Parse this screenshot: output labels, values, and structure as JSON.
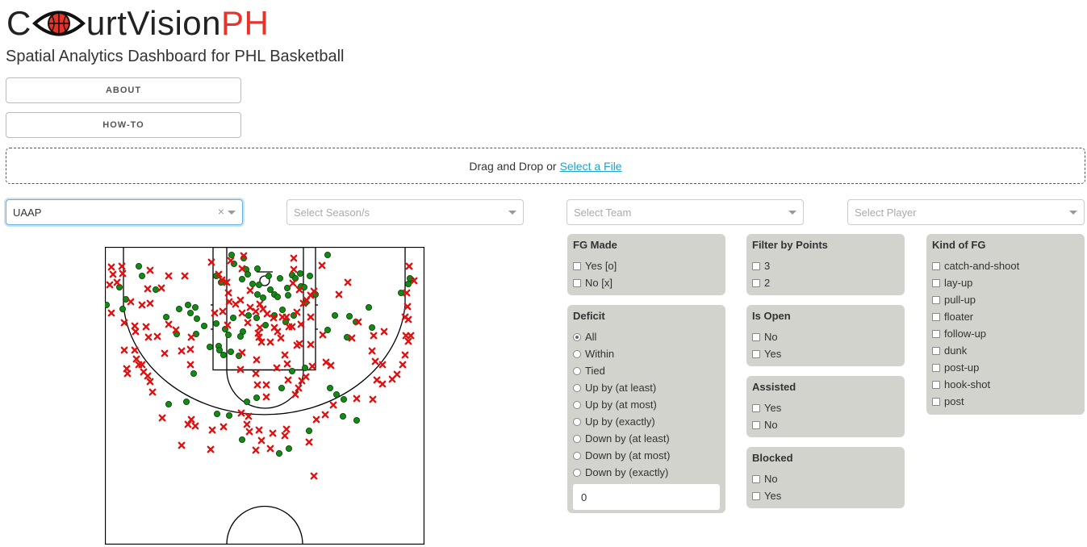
{
  "logo": {
    "part1": "C",
    "part2": "urtVision",
    "part3": "PH"
  },
  "subtitle": "Spatial Analytics Dashboard for PHL Basketball",
  "nav": {
    "about": "ABOUT",
    "howto": "HOW-TO"
  },
  "upload": {
    "text": "Drag and Drop or",
    "link": "Select a File"
  },
  "selects": {
    "league": {
      "value": "UAAP",
      "clear": "×"
    },
    "season": {
      "placeholder": "Select Season/s"
    },
    "team": {
      "placeholder": "Select Team"
    },
    "player": {
      "placeholder": "Select Player"
    }
  },
  "filters": {
    "fg_made": {
      "title": "FG Made",
      "options": [
        "Yes [o]",
        "No [x]"
      ]
    },
    "deficit": {
      "title": "Deficit",
      "options": [
        "All",
        "Within",
        "Tied",
        "Up by (at least)",
        "Up by (at most)",
        "Up by (exactly)",
        "Down by (at least)",
        "Down by (at most)",
        "Down by (exactly)"
      ],
      "selected": "All",
      "value": "0"
    },
    "points": {
      "title": "Filter by Points",
      "options": [
        "3",
        "2"
      ]
    },
    "is_open": {
      "title": "Is Open",
      "options": [
        "No",
        "Yes"
      ]
    },
    "assisted": {
      "title": "Assisted",
      "options": [
        "Yes",
        "No"
      ]
    },
    "blocked": {
      "title": "Blocked",
      "options": [
        "No",
        "Yes"
      ]
    },
    "kind": {
      "title": "Kind of FG",
      "options": [
        "catch-and-shoot",
        "lay-up",
        "pull-up",
        "floater",
        "follow-up",
        "dunk",
        "post-up",
        "hook-shot",
        "post"
      ]
    }
  },
  "colors": {
    "made": "#138a13",
    "missed": "#e01010",
    "panel": "#d1d3cc",
    "brand_accent": "#e8332a",
    "link": "#1ea5c9"
  },
  "chart_data": {
    "type": "scatter",
    "title": "",
    "series": [
      {
        "marker": "circle-made",
        "points": [
          [
            132,
            378
          ],
          [
            148,
            356
          ],
          [
            156,
            371
          ],
          [
            152,
            383
          ],
          [
            172,
            330
          ],
          [
            176,
            342
          ],
          [
            193,
            359
          ],
          [
            206,
            393
          ],
          [
            219,
            414
          ],
          [
            222,
            383
          ],
          [
            233,
            378
          ],
          [
            236,
            388
          ],
          [
            242,
            381
          ],
          [
            243,
            414
          ],
          [
            240,
            463
          ],
          [
            209,
            501
          ],
          [
            231,
            498
          ],
          [
            244,
            395
          ],
          [
            253,
            404
          ],
          [
            260,
            430
          ],
          [
            287,
            316
          ],
          [
            290,
            327
          ],
          [
            302,
            320
          ],
          [
            305,
            334
          ],
          [
            307,
            340
          ],
          [
            300,
            346
          ],
          [
            313,
            352
          ],
          [
            319,
            333
          ],
          [
            321,
            353
          ],
          [
            326,
            369
          ],
          [
            333,
            342
          ],
          [
            335,
            359
          ],
          [
            340,
            365
          ],
          [
            344,
            368
          ],
          [
            347,
            345
          ],
          [
            350,
            384
          ],
          [
            356,
            357
          ],
          [
            357,
            366
          ],
          [
            362,
            341
          ],
          [
            366,
            345
          ],
          [
            372,
            339
          ],
          [
            373,
            355
          ],
          [
            377,
            356
          ],
          [
            379,
            375
          ],
          [
            364,
            391
          ],
          [
            354,
            399
          ],
          [
            340,
            391
          ],
          [
            329,
            403
          ],
          [
            318,
            394
          ],
          [
            301,
            411
          ],
          [
            308,
            391
          ],
          [
            289,
            394
          ],
          [
            296,
            441
          ],
          [
            268,
            401
          ],
          [
            271,
            429
          ],
          [
            272,
            434
          ],
          [
            277,
            440
          ],
          [
            279,
            408
          ],
          [
            283,
            415
          ],
          [
            286,
            436
          ],
          [
            298,
            417
          ],
          [
            319,
            365
          ],
          [
            384,
            342
          ],
          [
            406,
            316
          ],
          [
            391,
            365
          ],
          [
            406,
            409
          ],
          [
            415,
            391
          ],
          [
            433,
            392
          ],
          [
            441,
            399
          ],
          [
            457,
            381
          ],
          [
            461,
            406
          ],
          [
            430,
            418
          ],
          [
            442,
            521
          ],
          [
            409,
            481
          ],
          [
            417,
            489
          ],
          [
            426,
            495
          ],
          [
            425,
            516
          ],
          [
            362,
            460
          ],
          [
            378,
            456
          ],
          [
            349,
            481
          ],
          [
            318,
            493
          ],
          [
            383,
            534
          ],
          [
            358,
            556
          ],
          [
            346,
            562
          ],
          [
            306,
            498
          ],
          [
            284,
            515
          ],
          [
            269,
            513
          ],
          [
            300,
            545
          ],
          [
            497,
            363
          ],
          [
            510,
            347
          ],
          [
            506,
            352
          ],
          [
            508,
            345
          ],
          [
            268,
            342
          ],
          [
            274,
            350
          ]
        ]
      },
      {
        "marker": "x-missed",
        "points": [
          [
            138,
            331
          ],
          [
            140,
            340
          ],
          [
            151,
            330
          ],
          [
            152,
            339
          ],
          [
            136,
            353
          ],
          [
            145,
            350
          ],
          [
            138,
            388
          ],
          [
            162,
            374
          ],
          [
            176,
            378
          ],
          [
            186,
            376
          ],
          [
            154,
            400
          ],
          [
            167,
            404
          ],
          [
            168,
            411
          ],
          [
            181,
            405
          ],
          [
            184,
            418
          ],
          [
            195,
            417
          ],
          [
            218,
            409
          ],
          [
            209,
            402
          ],
          [
            154,
            434
          ],
          [
            167,
            434
          ],
          [
            169,
            445
          ],
          [
            157,
            457
          ],
          [
            158,
            463
          ],
          [
            172,
            452
          ],
          [
            176,
            452
          ],
          [
            178,
            461
          ],
          [
            183,
            466
          ],
          [
            186,
            473
          ],
          [
            189,
            486
          ],
          [
            204,
            438
          ],
          [
            225,
            435
          ],
          [
            236,
            433
          ],
          [
            237,
            418
          ],
          [
            236,
            452
          ],
          [
            186,
            335
          ],
          [
            209,
            342
          ],
          [
            229,
            342
          ],
          [
            183,
            358
          ],
          [
            200,
            357
          ],
          [
            262,
            325
          ],
          [
            271,
            340
          ],
          [
            281,
            350
          ],
          [
            283,
            363
          ],
          [
            284,
            374
          ],
          [
            276,
            386
          ],
          [
            266,
            388
          ],
          [
            282,
            403
          ],
          [
            300,
            388
          ],
          [
            307,
            400
          ],
          [
            317,
            386
          ],
          [
            320,
            413
          ],
          [
            322,
            406
          ],
          [
            298,
            372
          ],
          [
            286,
            323
          ],
          [
            302,
            317
          ],
          [
            300,
            333
          ],
          [
            310,
            360
          ],
          [
            310,
            381
          ],
          [
            322,
            377
          ],
          [
            326,
            383
          ],
          [
            331,
            389
          ],
          [
            339,
            394
          ],
          [
            340,
            406
          ],
          [
            358,
            405
          ],
          [
            362,
            405
          ],
          [
            373,
            402
          ],
          [
            368,
            387
          ],
          [
            371,
            359
          ],
          [
            376,
            376
          ],
          [
            380,
            372
          ],
          [
            385,
            366
          ],
          [
            363,
            351
          ],
          [
            364,
            334
          ],
          [
            355,
            393
          ],
          [
            348,
            419
          ],
          [
            371,
            426
          ],
          [
            385,
            427
          ],
          [
            400,
            415
          ],
          [
            404,
            449
          ],
          [
            410,
            453
          ],
          [
            387,
            454
          ],
          [
            379,
            467
          ],
          [
            374,
            472
          ],
          [
            370,
            481
          ],
          [
            366,
            489
          ],
          [
            343,
            456
          ],
          [
            330,
            477
          ],
          [
            330,
            492
          ],
          [
            319,
            477
          ],
          [
            317,
            463
          ],
          [
            318,
            446
          ],
          [
            298,
            458
          ],
          [
            300,
            437
          ],
          [
            321,
            418
          ],
          [
            324,
            424
          ],
          [
            335,
            424
          ],
          [
            344,
            411
          ],
          [
            353,
            440
          ],
          [
            356,
            451
          ],
          [
            357,
            471
          ],
          [
            368,
            428
          ],
          [
            389,
            361
          ],
          [
            399,
            329
          ],
          [
            420,
            365
          ],
          [
            431,
            350
          ],
          [
            444,
            399
          ],
          [
            436,
            419
          ],
          [
            463,
            416
          ],
          [
            461,
            435
          ],
          [
            476,
            411
          ],
          [
            502,
            393
          ],
          [
            503,
            416
          ],
          [
            509,
            416
          ],
          [
            506,
            423
          ],
          [
            502,
            440
          ],
          [
            499,
            452
          ],
          [
            492,
            464
          ],
          [
            486,
            470
          ],
          [
            474,
            452
          ],
          [
            465,
            448
          ],
          [
            467,
            471
          ],
          [
            474,
            476
          ],
          [
            462,
            495
          ],
          [
            442,
            494
          ],
          [
            413,
            502
          ],
          [
            403,
            514
          ],
          [
            392,
            520
          ],
          [
            383,
            548
          ],
          [
            353,
            540
          ],
          [
            355,
            532
          ],
          [
            321,
            533
          ],
          [
            324,
            546
          ],
          [
            338,
            537
          ],
          [
            335,
            556
          ],
          [
            317,
            558
          ],
          [
            309,
            535
          ],
          [
            306,
            526
          ],
          [
            308,
            516
          ],
          [
            299,
            512
          ],
          [
            277,
            529
          ],
          [
            261,
            557
          ],
          [
            263,
            533
          ],
          [
            242,
            528
          ],
          [
            237,
            520
          ],
          [
            233,
            526
          ],
          [
            225,
            552
          ],
          [
            201,
            518
          ],
          [
            389,
            590
          ],
          [
            507,
            330
          ],
          [
            513,
            348
          ],
          [
            504,
            363
          ],
          [
            505,
            380
          ],
          [
            506,
            396
          ],
          [
            364,
            320
          ],
          [
            350,
            393
          ],
          [
            292,
            377
          ],
          [
            275,
            347
          ],
          [
            385,
            393
          ]
        ]
      }
    ]
  }
}
